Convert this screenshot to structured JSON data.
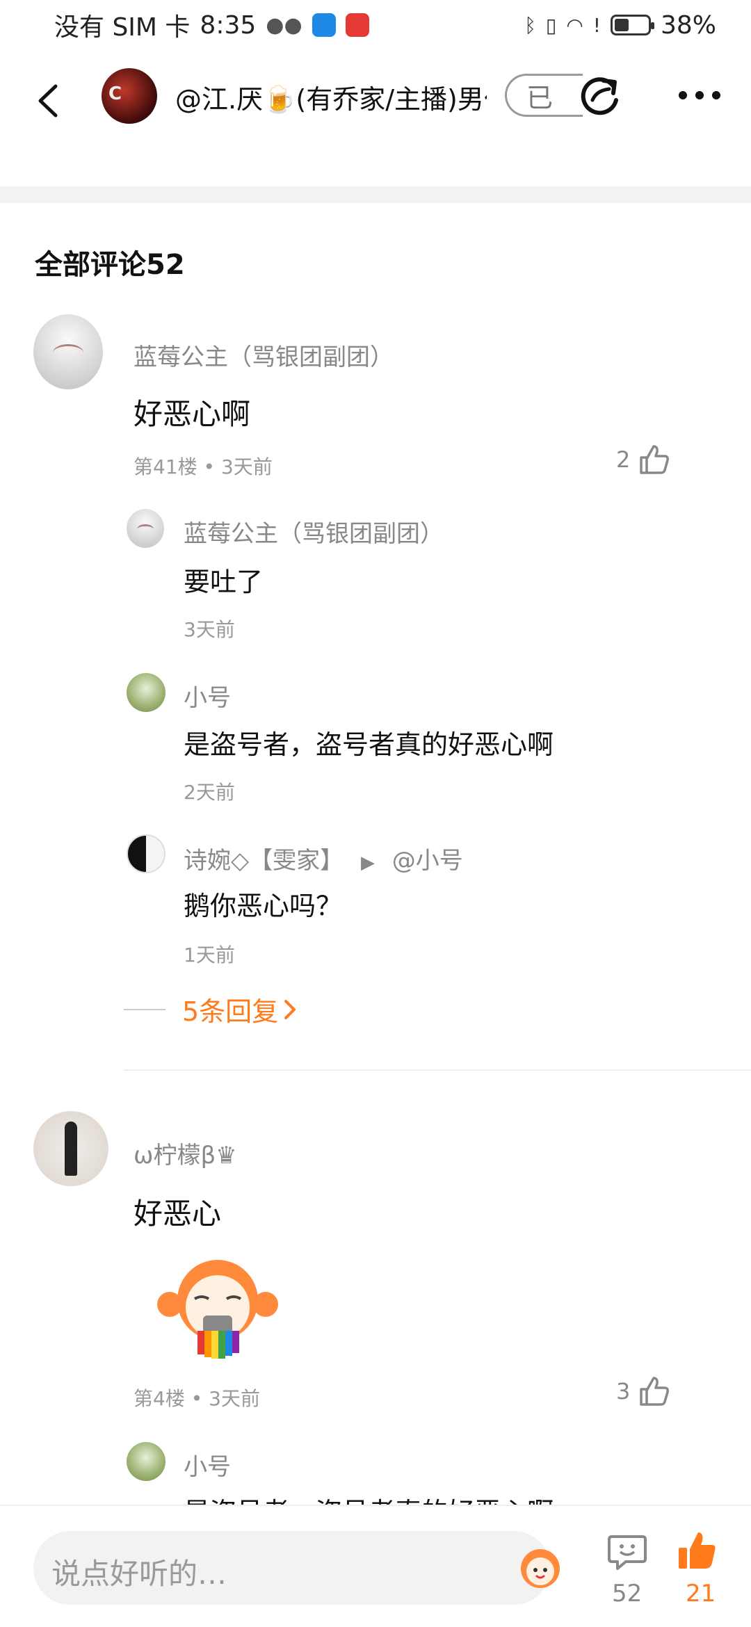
{
  "status_bar": {
    "carrier": "没有 SIM 卡",
    "time": "8:35",
    "battery": "38%",
    "battery_level": 0.38
  },
  "header": {
    "title": "@江.厌🍺(有乔家/主播)男仆",
    "avatar_text": "C",
    "follow_label": "已"
  },
  "comments_section": {
    "title": "全部评论52"
  },
  "comments": [
    {
      "author": "蓝莓公主（骂银团副团）",
      "text": "好恶心啊",
      "meta": "第41楼 • 3天前",
      "likes": "2",
      "replies": [
        {
          "author": "蓝莓公主（骂银团副团）",
          "text": "要吐了",
          "time": "3天前"
        },
        {
          "author": "小号",
          "text": "是盗号者，盗号者真的好恶心啊",
          "time": "2天前"
        },
        {
          "author": "诗婉◇【雯家】",
          "reply_to": "@小号",
          "text": "鹅你恶心吗？",
          "time": "1天前"
        }
      ],
      "more_replies": "5条回复"
    },
    {
      "author": "ω柠檬β♛",
      "text": "好恶心",
      "meta": "第4楼 • 3天前",
      "likes": "3",
      "replies": [
        {
          "author": "小号",
          "text": "是盗号者，盗号者真的好恶心啊"
        }
      ]
    }
  ],
  "bottom_bar": {
    "input_placeholder": "说点好听的…",
    "comment_count": "52",
    "like_count": "21"
  },
  "colors": {
    "accent_orange": "#ff7a1a",
    "text_gray": "#888888"
  }
}
